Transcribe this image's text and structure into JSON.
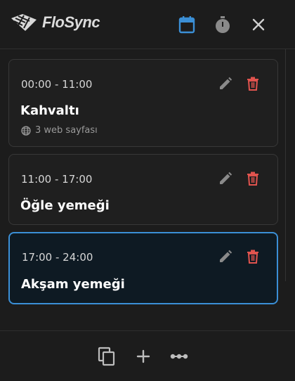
{
  "app": {
    "name": "FloSync",
    "icons": [
      "logo-mark",
      "calendar-icon",
      "timer-icon",
      "close-icon"
    ],
    "accent_color": "#3b8fd6",
    "delete_color": "#e0534e"
  },
  "entries": [
    {
      "time": "00:00 - 11:00",
      "title": "Kahvaltı",
      "meta": "3 web sayfası",
      "selected": false
    },
    {
      "time": "11:00 - 17:00",
      "title": "Öğle yemeği",
      "selected": false
    },
    {
      "time": "17:00 - 24:00",
      "title": "Akşam yemeği",
      "selected": true
    }
  ],
  "footer": {
    "icons": [
      "copy-icon",
      "add-icon",
      "more-icon"
    ]
  }
}
